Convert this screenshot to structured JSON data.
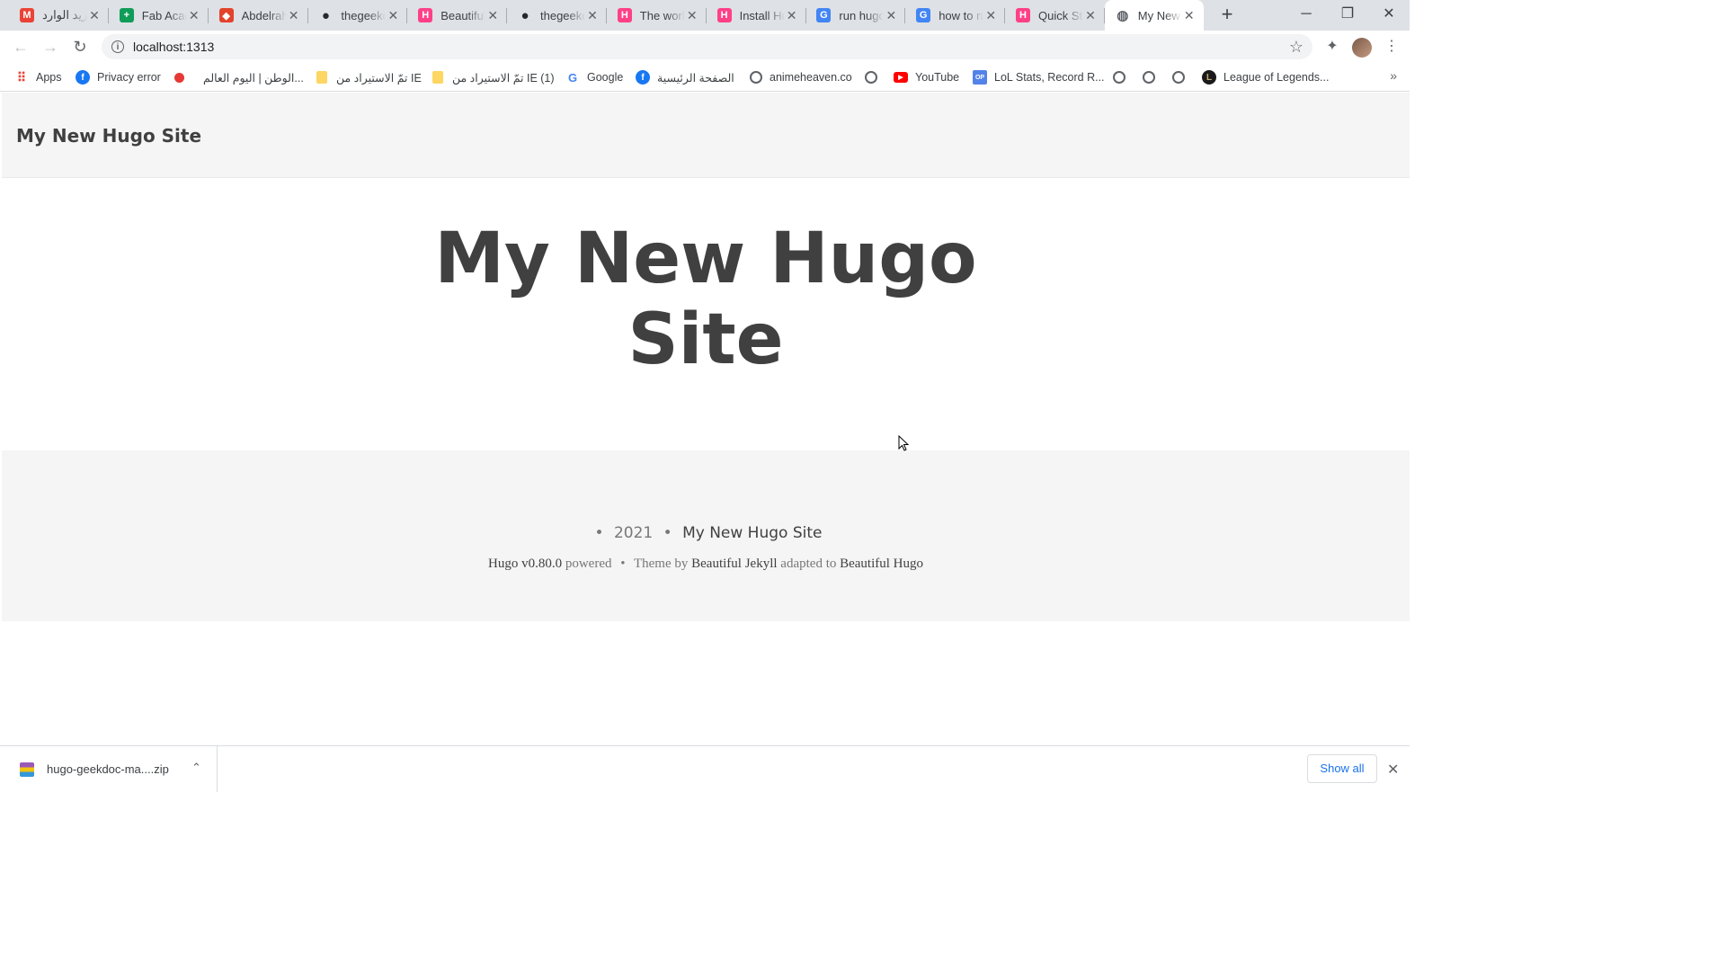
{
  "tabs": [
    {
      "title": "البريد الوارد",
      "favicon": "gmail-icon",
      "color": "#ea4335",
      "glyph": "M"
    },
    {
      "title": "Fab Academy",
      "favicon": "sheets-icon",
      "color": "#0f9d58",
      "glyph": "+"
    },
    {
      "title": "Abdelrahman",
      "favicon": "gitlab-icon",
      "color": "#e2432a",
      "glyph": "◆"
    },
    {
      "title": "thegeekdoc",
      "favicon": "github-icon",
      "color": "#24292e",
      "glyph": "●"
    },
    {
      "title": "Beautiful Hugo",
      "favicon": "hugo-icon",
      "color": "#ff4088",
      "glyph": "H"
    },
    {
      "title": "thegeekdoc",
      "favicon": "github-icon",
      "color": "#24292e",
      "glyph": "●"
    },
    {
      "title": "The world",
      "favicon": "hugo-icon",
      "color": "#ff4088",
      "glyph": "H"
    },
    {
      "title": "Install Hugo",
      "favicon": "hugo-icon",
      "color": "#ff4088",
      "glyph": "H"
    },
    {
      "title": "run hugo",
      "favicon": "google-icon",
      "color": "#4285f4",
      "glyph": "G"
    },
    {
      "title": "how to run",
      "favicon": "google-icon",
      "color": "#4285f4",
      "glyph": "G"
    },
    {
      "title": "Quick Start",
      "favicon": "hugo-icon",
      "color": "#ff4088",
      "glyph": "H"
    },
    {
      "title": "My New Hugo Site",
      "favicon": "globe-icon",
      "color": "#5f6368",
      "glyph": "◍",
      "active": true
    }
  ],
  "toolbar": {
    "url": "localhost:1313"
  },
  "bookmarks": [
    {
      "label": "Apps",
      "icon": "apps-icon"
    },
    {
      "label": "Privacy error",
      "icon": "facebook-icon"
    },
    {
      "label": "",
      "icon": "red-dot-icon"
    },
    {
      "label": "الوطن | اليوم العالم...",
      "icon": "none"
    },
    {
      "label": "تمّ الاستيراد من IE",
      "icon": "folder-icon"
    },
    {
      "label": "تمّ الاستيراد من IE (1)",
      "icon": "folder-icon"
    },
    {
      "label": "Google",
      "icon": "google-icon"
    },
    {
      "label": "الصفحة الرئيسية",
      "icon": "facebook-icon"
    },
    {
      "label": "animeheaven.co",
      "icon": "globe-icon"
    },
    {
      "label": "",
      "icon": "globe-icon"
    },
    {
      "label": "YouTube",
      "icon": "youtube-icon"
    },
    {
      "label": "LoL Stats, Record R...",
      "icon": "opgg-icon"
    },
    {
      "label": "",
      "icon": "globe-icon"
    },
    {
      "label": "",
      "icon": "globe-icon"
    },
    {
      "label": "",
      "icon": "globe-icon"
    },
    {
      "label": "League of Legends...",
      "icon": "league-icon"
    }
  ],
  "page": {
    "brand": "My New Hugo Site",
    "hero_line1": "My New Hugo",
    "hero_line2": "Site",
    "footer": {
      "bullet": "•",
      "year": "2021",
      "site": "My New Hugo Site",
      "hugo_version": "Hugo v0.80.0",
      "powered": "powered",
      "theme_by": "Theme by",
      "jekyll": "Beautiful Jekyll",
      "adapted_to": "adapted to",
      "hugo_theme": "Beautiful Hugo"
    }
  },
  "download": {
    "filename": "hugo-geekdoc-ma....zip",
    "show_all": "Show all"
  }
}
